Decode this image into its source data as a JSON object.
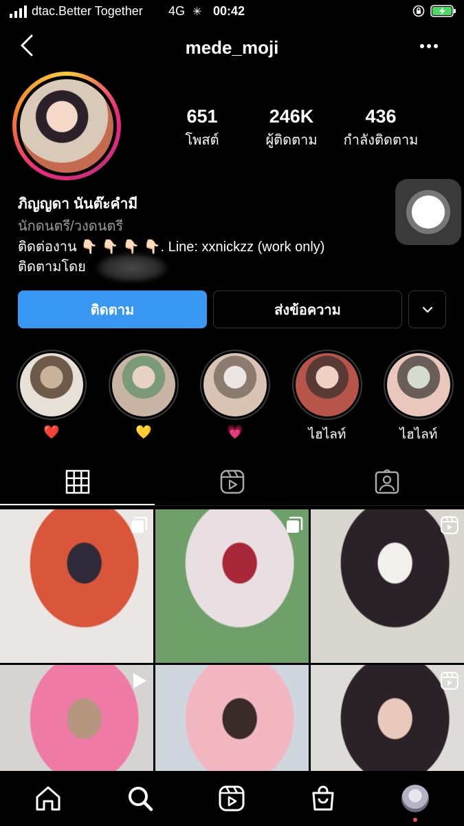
{
  "status_bar": {
    "carrier": "dtac.Better Together",
    "network": "4G",
    "time": "00:42"
  },
  "header": {
    "username": "mede_moji"
  },
  "stats": [
    {
      "value": "651",
      "label": "โพสต์"
    },
    {
      "value": "246K",
      "label": "ผู้ติดตาม"
    },
    {
      "value": "436",
      "label": "กำลังติดตาม"
    }
  ],
  "bio": {
    "full_name": "ภิญญดา นันต๊ะคำมี",
    "category": "นักดนตรี/วงดนตรี",
    "line1": "ติดต่องาน 👇🏻 👇🏻 👇🏻 👇🏻. Line: xxnickzz (work only)",
    "followed_by": "ติดตามโดย"
  },
  "buttons": {
    "follow": "ติดตาม",
    "message": "ส่งข้อความ"
  },
  "highlights": [
    {
      "label": "❤️",
      "colors": [
        "#c9b29a",
        "#6e5a48",
        "#e6e0d6"
      ]
    },
    {
      "label": "💛",
      "colors": [
        "#e8d2c8",
        "#7a9a78",
        "#c7b4a4"
      ]
    },
    {
      "label": "💗",
      "colors": [
        "#ece6e4",
        "#8c7c70",
        "#d9c3b5"
      ]
    },
    {
      "label": "ไฮไลท์",
      "colors": [
        "#eed3c4",
        "#5a3a34",
        "#b8554a"
      ]
    },
    {
      "label": "ไฮไลท์",
      "colors": [
        "#d7dcd0",
        "#6a5e58",
        "#e9c7bc"
      ]
    }
  ],
  "tabs": [
    "grid-icon",
    "reels-icon",
    "tagged-icon"
  ],
  "posts": [
    {
      "type": "multiple",
      "colors": [
        "#e9e6e4",
        "#d9563a",
        "#2e2a3a"
      ]
    },
    {
      "type": "multiple",
      "colors": [
        "#6fa06a",
        "#e9dfe2",
        "#a8283a"
      ]
    },
    {
      "type": "reel",
      "colors": [
        "#d9d6cf",
        "#2a2228",
        "#f2f0ec"
      ]
    },
    {
      "type": "video",
      "colors": [
        "#d6d4d2",
        "#f07aa6",
        "#b79680"
      ]
    },
    {
      "type": "none",
      "colors": [
        "#cfd6de",
        "#f2b7c0",
        "#3a2a2a"
      ]
    },
    {
      "type": "reel",
      "colors": [
        "#dedcd8",
        "#2a2226",
        "#e9c9bc"
      ]
    }
  ],
  "nav": [
    "home-icon",
    "search-icon",
    "reels-icon",
    "shop-icon",
    "profile-avatar"
  ]
}
